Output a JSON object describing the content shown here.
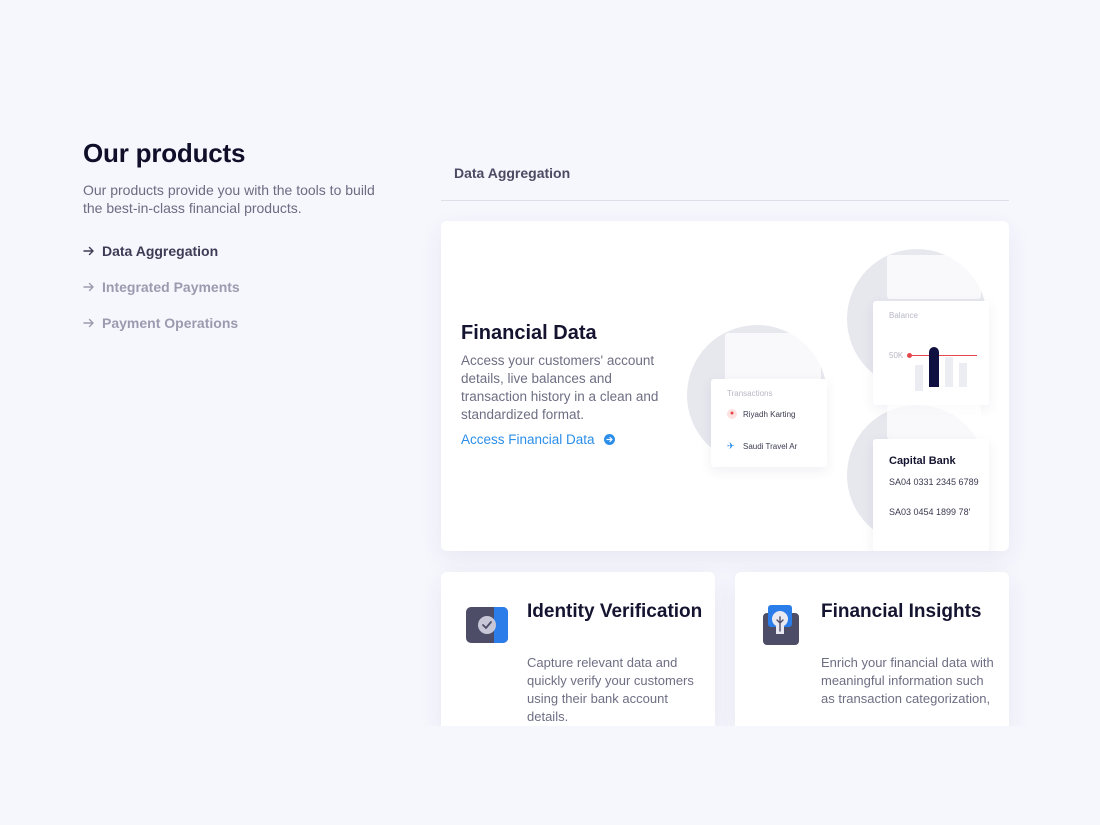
{
  "sidebar": {
    "title": "Our products",
    "subtitle": "Our products provide you with the tools to build the best-in-class financial products.",
    "items": [
      {
        "label": "Data Aggregation",
        "active": true
      },
      {
        "label": "Integrated Payments",
        "active": false
      },
      {
        "label": "Payment Operations",
        "active": false
      }
    ]
  },
  "tabbar": {
    "current": "Data Aggregation"
  },
  "main_card": {
    "title": "Financial Data",
    "description": "Access your customers' account details, live balances and transaction history in a clean and standardized format.",
    "link_label": "Access Financial Data",
    "illustration": {
      "transactions_label": "Transactions",
      "tx1": "Riyadh Karting",
      "tx2": "Saudi Travel Ar",
      "balance_label": "Balance",
      "balance_value": "50K",
      "bank_name": "Capital Bank",
      "iban1": "SA04 0331 2345 6789",
      "iban2": "SA03 0454 1899 78'"
    }
  },
  "identity_card": {
    "title": "Identity Verification",
    "description": "Capture relevant data and quickly verify your customers using their bank account details."
  },
  "insights_card": {
    "title": "Financial Insights",
    "description": "Enrich your financial data with meaningful information such as transaction categorization,"
  },
  "colors": {
    "background": "#f6f6fd",
    "accent_blue": "#2c8ee8",
    "icon_dark": "#4d4d68",
    "icon_blue": "#2b7de9",
    "balance_bar": "#101040",
    "balance_line": "#e5484d"
  },
  "icons": [
    "arrow-right-icon",
    "arrow-circle-right-icon",
    "check-shield-icon",
    "lightbulb-icon",
    "fire-icon",
    "plane-icon"
  ]
}
